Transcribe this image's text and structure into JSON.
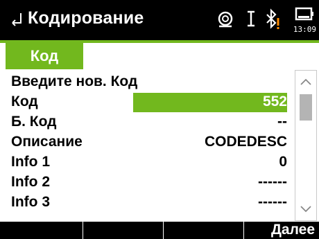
{
  "titlebar": {
    "title": "Кодирование",
    "time": "13:09"
  },
  "icons": {
    "back": "back-arrow-icon",
    "prism": "prism-target-icon",
    "cursor": "text-cursor-icon",
    "bluetooth": "bluetooth-warning-icon",
    "battery": "battery-icon"
  },
  "tab": {
    "label": "Код"
  },
  "fields": [
    {
      "label": "Введите нов. Код",
      "value": ""
    },
    {
      "label": "Код",
      "value": "552"
    },
    {
      "label": "Б. Код",
      "value": "--"
    },
    {
      "label": "Описание",
      "value": "CODEDESC"
    },
    {
      "label": "Info 1",
      "value": "0"
    },
    {
      "label": "Info 2",
      "value": "------"
    },
    {
      "label": "Info 3",
      "value": "------"
    }
  ],
  "softkeys": [
    "",
    "",
    "",
    "Далее"
  ],
  "colors": {
    "accent": "#72b81e",
    "bar": "#000000",
    "warning": "#ff8c00"
  }
}
